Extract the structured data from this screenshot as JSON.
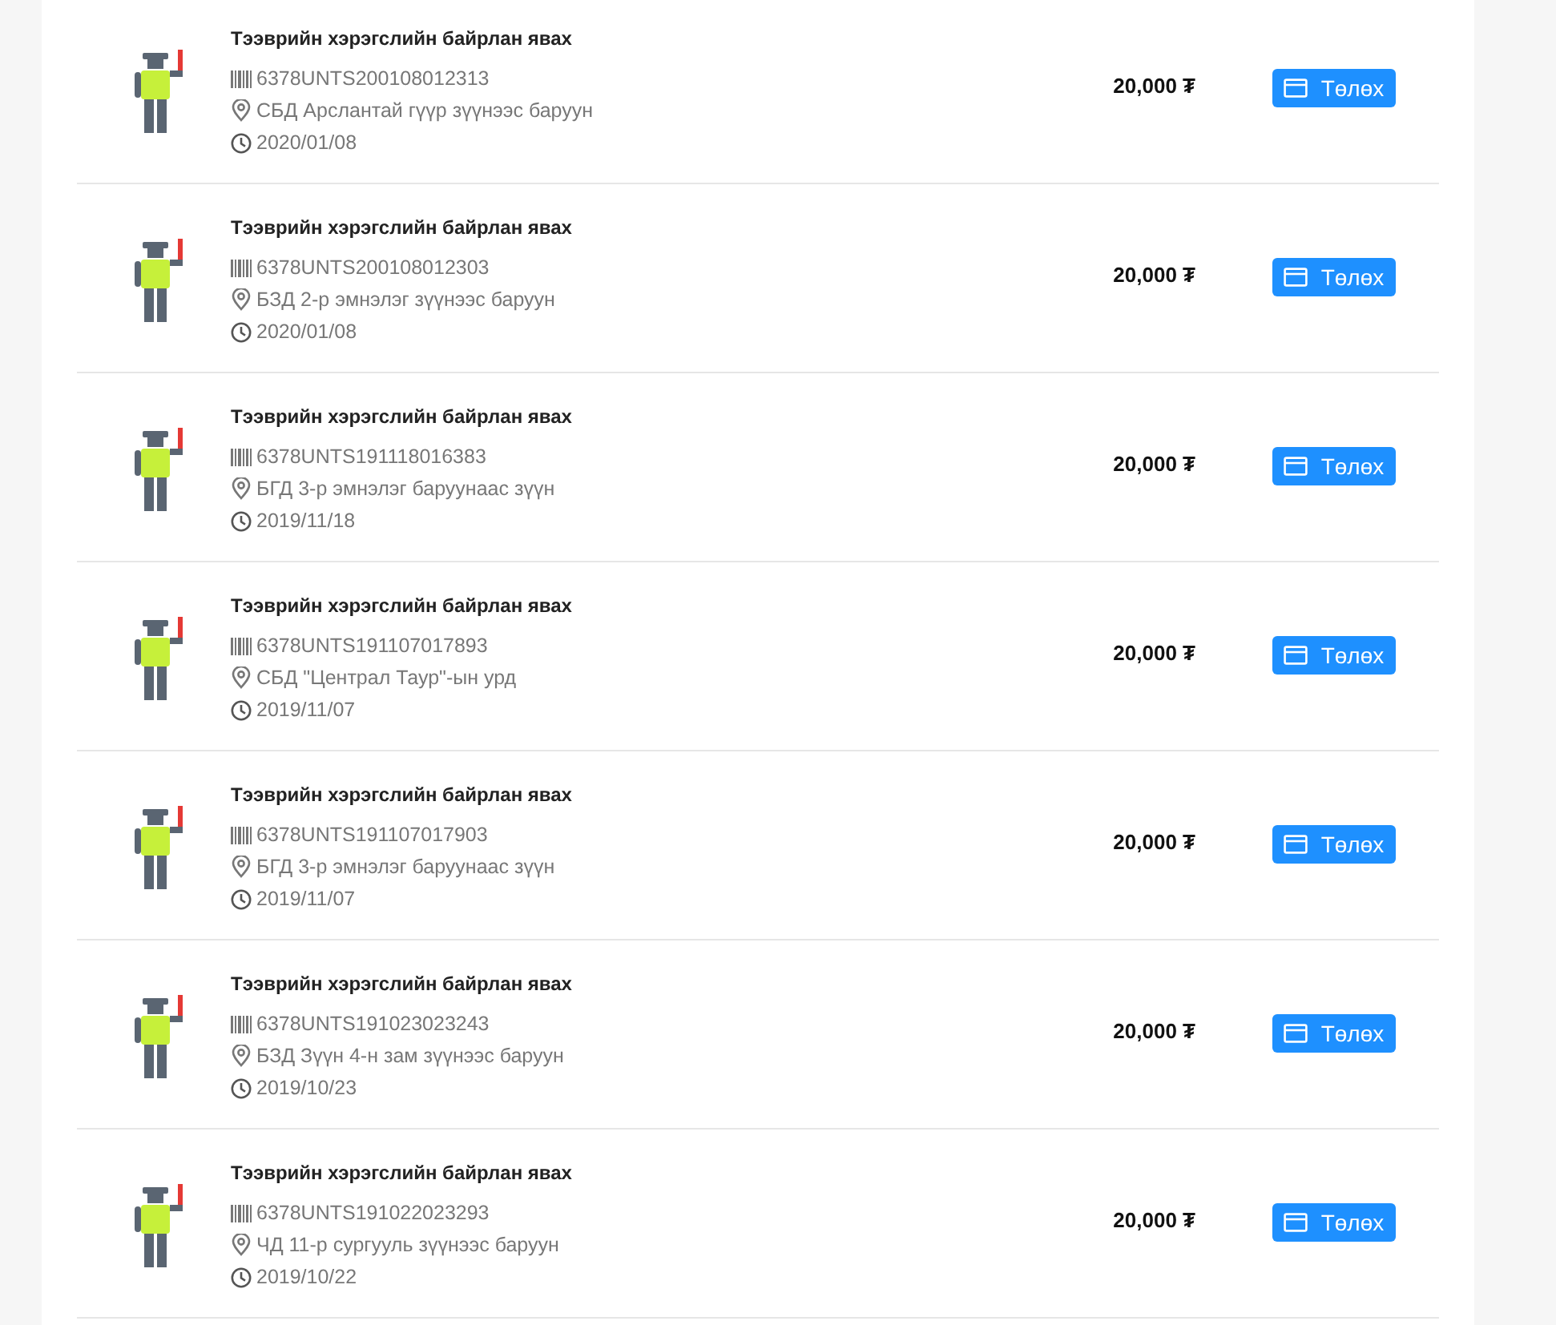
{
  "fines": [
    {
      "title": "Тээврийн хэрэгслийн байрлан явах",
      "code": "6378UNTS200108012313",
      "location": "СБД Арслантай гүүр зүүнээс баруун",
      "date": "2020/01/08",
      "amount": "20,000 ₮",
      "button": "Төлөх"
    },
    {
      "title": "Тээврийн хэрэгслийн байрлан явах",
      "code": "6378UNTS200108012303",
      "location": "БЗД 2-р эмнэлэг зүүнээс баруун",
      "date": "2020/01/08",
      "amount": "20,000 ₮",
      "button": "Төлөх"
    },
    {
      "title": "Тээврийн хэрэгслийн байрлан явах",
      "code": "6378UNTS191118016383",
      "location": "БГД 3-р эмнэлэг баруунаас зүүн",
      "date": "2019/11/18",
      "amount": "20,000 ₮",
      "button": "Төлөх"
    },
    {
      "title": "Тээврийн хэрэгслийн байрлан явах",
      "code": "6378UNTS191107017893",
      "location": "СБД \"Централ Таур\"-ын урд",
      "date": "2019/11/07",
      "amount": "20,000 ₮",
      "button": "Төлөх"
    },
    {
      "title": "Тээврийн хэрэгслийн байрлан явах",
      "code": "6378UNTS191107017903",
      "location": "БГД 3-р эмнэлэг баруунаас зүүн",
      "date": "2019/11/07",
      "amount": "20,000 ₮",
      "button": "Төлөх"
    },
    {
      "title": "Тээврийн хэрэгслийн байрлан явах",
      "code": "6378UNTS191023023243",
      "location": "БЗД Зүүн 4-н зам зүүнээс баруун",
      "date": "2019/10/23",
      "amount": "20,000 ₮",
      "button": "Төлөх"
    },
    {
      "title": "Тээврийн хэрэгслийн байрлан явах",
      "code": "6378UNTS191022023293",
      "location": "ЧД 11-р сургууль зүүнээс баруун",
      "date": "2019/10/22",
      "amount": "20,000 ₮",
      "button": "Төлөх"
    }
  ]
}
